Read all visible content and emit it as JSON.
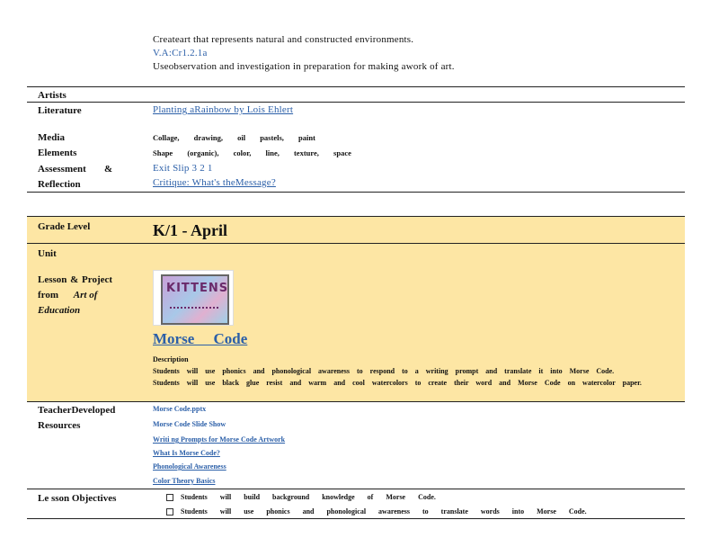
{
  "standards": {
    "line1": "Createart   that represents   natural and constructed   environments.",
    "line2": "V.A:Cr1.2.1a",
    "line3": "Useobservation   and investigation   in preparation   for making   awork  of art."
  },
  "top_table": {
    "artists_label": "Artists",
    "literature_label": "Literature",
    "literature_link": "Planting   aRainbow   by Lois  Ehlert",
    "media_label": "Media",
    "media_value": "Collage, drawing, oil pastels, paint",
    "elements_label": "Elements",
    "elements_value": "Shape (organic), color, line, texture, space",
    "assessment_label": "Assessment",
    "assessment_amp": "&",
    "assessment_value": "Exit Slip  3  2  1",
    "reflection_label": "Reflection",
    "reflection_value": "Critique:   What's   theMessage?"
  },
  "grade": {
    "label": "Grade    Level",
    "value": "K/1   -  April"
  },
  "unit": {
    "label": "Unit"
  },
  "lesson": {
    "label_line1": "Lesson     & Project",
    "label_line2_a": "from",
    "label_line2_b": "Art   of",
    "label_line3": "Education",
    "thumb_text": "KITTENS",
    "title": "Morse     Code",
    "description_label": "Description",
    "description_line1": "Students  will use phonics and phonological  awareness  to respond  to a writing prompt  and translate  it into Morse Code.",
    "description_line2": "Students  will use black glue resist and warm and cool watercolors  to create their word and Morse Code on watercolor paper."
  },
  "resources": {
    "label_line1": "TeacherDeveloped",
    "label_line2": "Resources",
    "items": [
      "Morse    Code.pptx",
      "Morse    Code    Slide    Show",
      "Writi   ng  Prompts    for  Morse    Code    Artwork",
      "What    Is  Morse    Code?",
      "Phonological        Awareness",
      "Color    Theory    Basics"
    ]
  },
  "objectives": {
    "label": "Le sson    Objectives",
    "items": [
      "Students will build background knowledge of Morse Code.",
      "Students will use phonics and phonological awareness to translate words into Morse Code."
    ]
  },
  "colors": {
    "band": "#fde6a4",
    "link": "#2b5fa8"
  }
}
